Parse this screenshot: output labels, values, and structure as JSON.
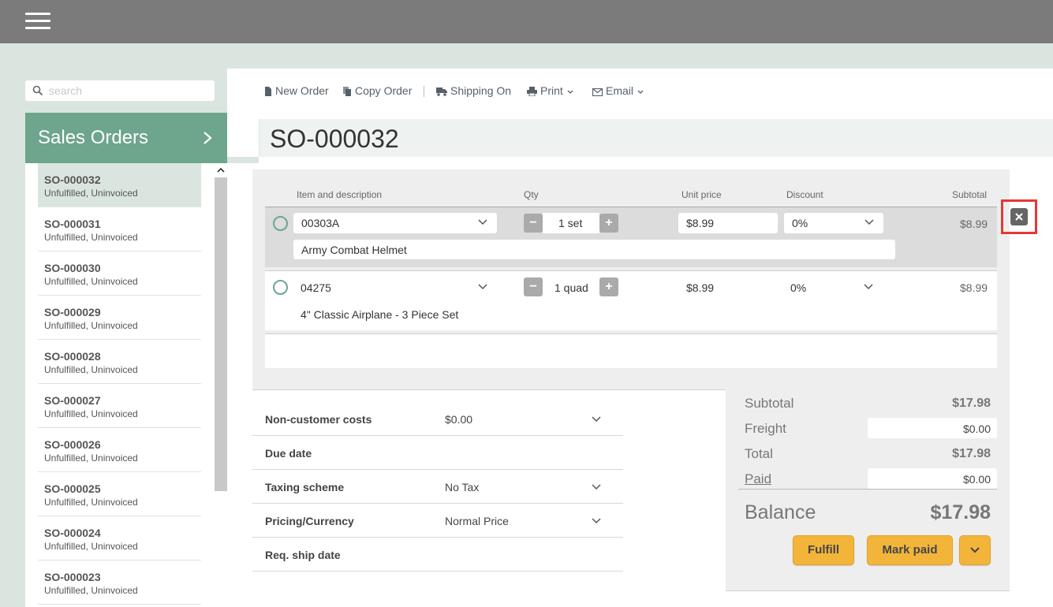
{
  "topbar": {
    "menu_icon": "hamburger-menu-icon"
  },
  "sidebar": {
    "search_placeholder": "search",
    "header_title": "Sales Orders",
    "orders": [
      {
        "number": "SO-000032",
        "status": "Unfulfilled, Uninvoiced",
        "active": true
      },
      {
        "number": "SO-000031",
        "status": "Unfulfilled, Uninvoiced"
      },
      {
        "number": "SO-000030",
        "status": "Unfulfilled, Uninvoiced"
      },
      {
        "number": "SO-000029",
        "status": "Unfulfilled, Uninvoiced"
      },
      {
        "number": "SO-000028",
        "status": "Unfulfilled, Uninvoiced"
      },
      {
        "number": "SO-000027",
        "status": "Unfulfilled, Uninvoiced"
      },
      {
        "number": "SO-000026",
        "status": "Unfulfilled, Uninvoiced"
      },
      {
        "number": "SO-000025",
        "status": "Unfulfilled, Uninvoiced"
      },
      {
        "number": "SO-000024",
        "status": "Unfulfilled, Uninvoiced"
      },
      {
        "number": "SO-000023",
        "status": "Unfulfilled, Uninvoiced"
      }
    ]
  },
  "toolbar": {
    "new_order": "New Order",
    "copy_order": "Copy Order",
    "shipping": "Shipping On",
    "print": "Print",
    "email": "Email"
  },
  "order": {
    "title": "SO-000032",
    "columns": {
      "item": "Item and description",
      "qty": "Qty",
      "unit_price": "Unit price",
      "discount": "Discount",
      "subtotal": "Subtotal"
    },
    "lines": [
      {
        "item": "00303A",
        "description": "Army Combat Helmet",
        "qty": "1 set",
        "unit_price": "$8.99",
        "discount": "0%",
        "subtotal": "$8.99"
      },
      {
        "item": "04275",
        "description": "4\" Classic Airplane - 3 Piece Set",
        "qty": "1 quad",
        "unit_price": "$8.99",
        "discount": "0%",
        "subtotal": "$8.99"
      }
    ],
    "qty_minus": "−",
    "qty_plus": "+"
  },
  "details": {
    "non_customer_costs_label": "Non-customer costs",
    "non_customer_costs_value": "$0.00",
    "due_date_label": "Due date",
    "taxing_scheme_label": "Taxing scheme",
    "taxing_scheme_value": "No Tax",
    "pricing_label": "Pricing/Currency",
    "pricing_value": "Normal Price",
    "req_ship_label": "Req. ship date"
  },
  "summary": {
    "subtotal_label": "Subtotal",
    "subtotal_value": "$17.98",
    "freight_label": "Freight",
    "freight_value": "$0.00",
    "total_label": "Total",
    "total_value": "$17.98",
    "paid_label": "Paid",
    "paid_value": "$0.00",
    "balance_label": "Balance",
    "balance_value": "$17.98",
    "fulfill_label": "Fulfill",
    "mark_paid_label": "Mark paid"
  },
  "colors": {
    "topbar": "#7b7b7b",
    "page_bg": "#dbe5df",
    "accent_green": "#6ea58d",
    "button_yellow": "#f2b53a",
    "highlight_red": "#e53935"
  }
}
